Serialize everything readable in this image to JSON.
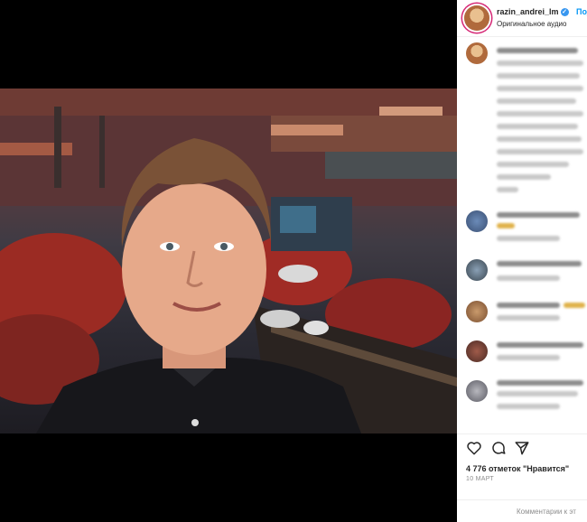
{
  "post": {
    "username": "razin_andrei_lm",
    "verified_icon": "✓",
    "follow_label": "Под",
    "audio_label": "Оригинальное аудио"
  },
  "comments": [
    {
      "avatar": "avatar-1"
    },
    {
      "avatar": "avatar-2"
    },
    {
      "avatar": "avatar-3"
    },
    {
      "avatar": "avatar-4"
    },
    {
      "avatar": "avatar-5"
    },
    {
      "avatar": "avatar-6"
    }
  ],
  "actions": {
    "likes_text": "4 776 отметок \"Нравится\"",
    "date_text": "10 МАРТ",
    "add_comment_placeholder": "Комментарии к эт"
  },
  "colors": {
    "accent": "#0095f6",
    "verified": "#3897f0",
    "ring": "#d62976"
  }
}
